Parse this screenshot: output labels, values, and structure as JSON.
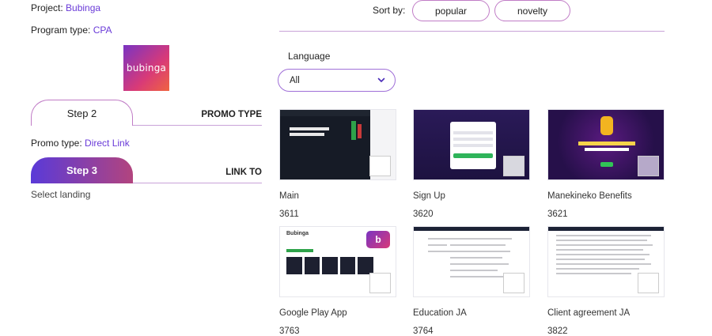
{
  "project": {
    "label": "Project:",
    "value": "Bubinga"
  },
  "program": {
    "label": "Program type:",
    "value": "CPA"
  },
  "logo": {
    "text": "bubinga"
  },
  "steps": [
    {
      "label": "Step 2",
      "right": "PROMO TYPE"
    },
    {
      "label": "Step 3",
      "right": "LINK TO"
    }
  ],
  "promo_type": {
    "label": "Promo type:",
    "value": "Direct Link"
  },
  "select_landing": "Select landing",
  "sort": {
    "label": "Sort by:",
    "options": [
      "popular",
      "novelty"
    ]
  },
  "language": {
    "label": "Language",
    "value": "All"
  },
  "thumb_text": {
    "google_play_brand": "Bubinga",
    "google_play_icon": "b"
  },
  "landings": [
    {
      "name": "Main",
      "id": "3611"
    },
    {
      "name": "Sign Up",
      "id": "3620"
    },
    {
      "name": "Manekineko Benefits",
      "id": "3621"
    },
    {
      "name": "Google Play App",
      "id": "3763"
    },
    {
      "name": "Education JA",
      "id": "3764"
    },
    {
      "name": "Client agreement JA",
      "id": "3822"
    }
  ],
  "colors": {
    "accent": "#6a3bd8",
    "step_gradient_start": "#5a3ad8",
    "step_gradient_end": "#b2447e",
    "outline": "#c07cc6"
  }
}
